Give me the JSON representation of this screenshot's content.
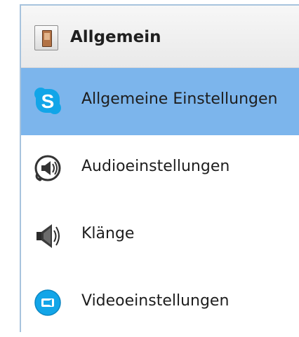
{
  "header": {
    "title": "Allgemein",
    "icon": "switch-icon"
  },
  "menu": {
    "items": [
      {
        "label": "Allgemeine Einstellungen",
        "icon": "skype-icon",
        "selected": true
      },
      {
        "label": "Audioeinstellungen",
        "icon": "headset-speaker-icon",
        "selected": false
      },
      {
        "label": "Klänge",
        "icon": "speaker-icon",
        "selected": false
      },
      {
        "label": "Videoeinstellungen",
        "icon": "video-camera-icon",
        "selected": false
      }
    ]
  },
  "colors": {
    "selected_background": "#7cb5ec",
    "border": "#a7c3dd",
    "skype_blue": "#12a5e8"
  }
}
